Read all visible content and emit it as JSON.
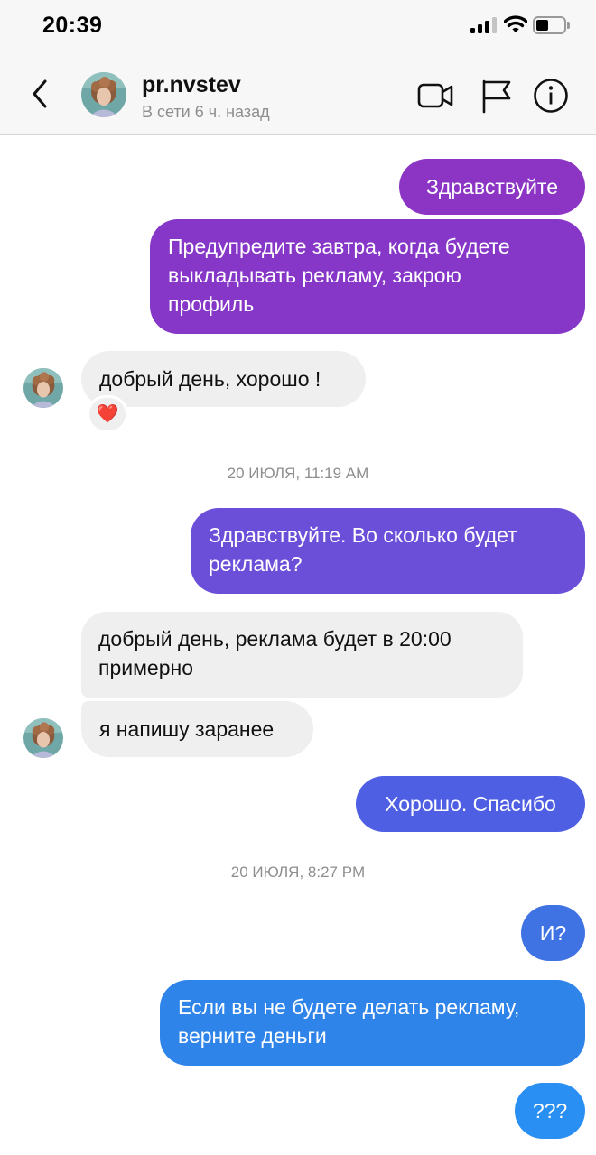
{
  "status_bar": {
    "time": "20:39"
  },
  "header": {
    "username": "pr.nvstev",
    "status": "В сети 6 ч. назад",
    "icons": [
      "back-chevron-icon",
      "video-camera-icon",
      "flag-icon",
      "info-icon"
    ]
  },
  "messages": {
    "m1": "Здравствуйте",
    "m2_line1": "Предупредите завтра, когда будете",
    "m2_line2": "выкладывать рекламу, закрою",
    "m2_line3": "профиль",
    "m3": "добрый день, хорошо !",
    "m3_reaction": "❤️",
    "ts1": "20 ИЮЛЯ, 11:19 AM",
    "m4_line1": "Здравствуйте. Во сколько будет",
    "m4_line2": "реклама?",
    "m5_line1": "добрый день, реклама будет в 20:00",
    "m5_line2": "примерно",
    "m6": "я напишу заранее",
    "m7": "Хорошо. Спасибо",
    "ts2": "20 ИЮЛЯ, 8:27 PM",
    "m8": "И?",
    "m9_line1": "Если вы не будете делать рекламу,",
    "m9_line2": "верните деньги",
    "m10": "???"
  },
  "colors": {
    "sent_purple": "#8a37c6",
    "sent_violet": "#6952d9",
    "sent_indigo": "#4f5fe6",
    "sent_blue": "#2f7fe8",
    "sent_bright_blue": "#2a8ef2",
    "received_bg": "#efefef"
  }
}
